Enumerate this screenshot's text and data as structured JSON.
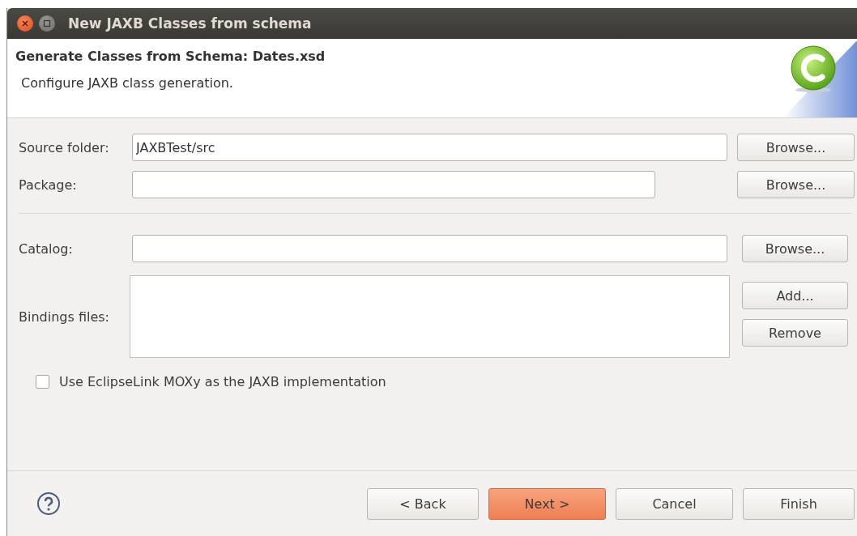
{
  "window": {
    "title": "New JAXB Classes from schema"
  },
  "header": {
    "title": "Generate Classes from Schema: Dates.xsd",
    "description": "Configure JAXB class generation."
  },
  "sections": [
    {
      "rows": [
        {
          "kind": "text",
          "label": "Source folder:",
          "value": "JAXBTest/src",
          "buttons": [
            {
              "label": "Browse..."
            }
          ]
        },
        {
          "kind": "text",
          "label": "Package:",
          "buttons": [
            {
              "label": "Browse..."
            }
          ]
        }
      ]
    },
    {
      "rows": [
        {
          "kind": "text",
          "label": "Catalog:",
          "buttons": [
            {
              "label": "Browse..."
            }
          ]
        },
        {
          "kind": "list",
          "label": "Bindings files:",
          "buttons": [
            {
              "label": "Add..."
            },
            {
              "label": "Remove"
            }
          ]
        }
      ]
    }
  ],
  "options": [
    {
      "label": "Use EclipseLink MOXy as the JAXB implementation",
      "checked": false
    }
  ],
  "footer_buttons": [
    {
      "label": "< Back",
      "default": false
    },
    {
      "label": "Next >",
      "default": true
    },
    {
      "label": "Cancel",
      "default": false
    },
    {
      "label": "Finish",
      "default": false
    }
  ]
}
